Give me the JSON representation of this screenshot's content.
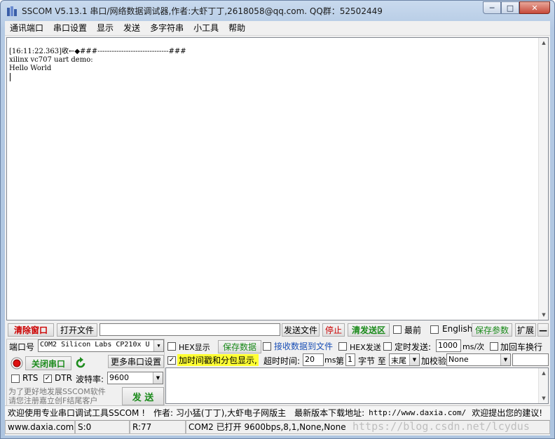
{
  "window": {
    "title": "SSCOM V5.13.1 串口/网络数据调试器,作者:大虾丁丁,2618058@qq.com. QQ群：52502449",
    "controls": {
      "minimize": "─",
      "maximize": "□",
      "close": "✕"
    }
  },
  "menu": [
    "通讯端口",
    "串口设置",
    "显示",
    "发送",
    "多字符串",
    "小工具",
    "帮助"
  ],
  "output": {
    "lines": [
      "[16:11:22.363]收←◆###------------------------------###",
      "xilinx vc707 uart demo:",
      "Hello World"
    ]
  },
  "toolbar1": {
    "clear_window": "清除窗口",
    "open_file": "打开文件",
    "file_path": "",
    "send_file": "发送文件",
    "stop": "停止",
    "clear_send": "清发送区",
    "topmost_label": "最前",
    "english_label": "English",
    "save_params": "保存参数",
    "expand": "扩展",
    "collapse": "—"
  },
  "port_panel": {
    "port_label": "端口号",
    "port_value": "COM2 Silicon Labs CP210x U",
    "close_port": "关闭串口",
    "more_settings": "更多串口设置",
    "rts_label": "RTS",
    "dtr_label": "DTR",
    "baud_label": "波特率:",
    "baud_value": "9600",
    "promo_text": "为了更好地发展SSCOM软件\n请您注册嘉立创F结尾客户",
    "send_button": "发  送"
  },
  "options": {
    "hex_display": "HEX显示",
    "save_data": "保存数据",
    "recv_to_file": "接收数据到文件",
    "hex_send": "HEX发送",
    "timed_send": "定时发送:",
    "interval_value": "1000",
    "interval_unit": "ms/次",
    "add_crlf": "加回车换行",
    "timestamp": "加时间戳和分包显示,",
    "timeout_label": "超时时间:",
    "timeout_value": "20",
    "timeout_unit": "ms",
    "byte_prefix": "第",
    "byte_value": "1",
    "byte_mid": "字节 至",
    "byte_end": "末尾",
    "checksum_label": "加校验",
    "checksum_value": "None"
  },
  "info_bar": {
    "welcome": "欢迎使用专业串口调试工具SSCOM !",
    "author": "作者: 习小猛(丁丁),大虾电子网版主",
    "download_label": "最新版本下载地址:",
    "download_url": "http://www.daxia.com/",
    "feedback": "欢迎提出您的建议!"
  },
  "status_bar": {
    "website": "www.daxia.com",
    "sent": "S:0",
    "received": "R:77",
    "port_status": "COM2 已打开  9600bps,8,1,None,None"
  },
  "watermark": "https://blog.csdn.net/lcydus",
  "colors": {
    "accent_red": "#cc0000",
    "accent_green": "#1a8a1a",
    "highlight": "#ffff33"
  }
}
